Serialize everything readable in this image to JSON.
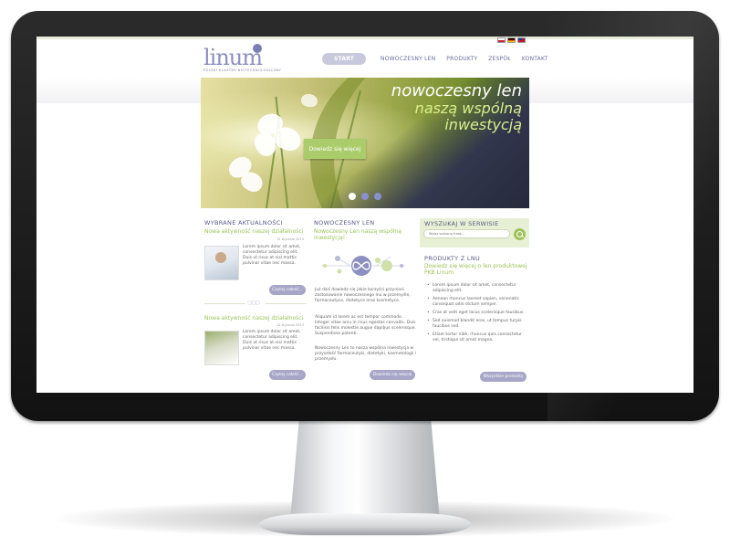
{
  "site": {
    "logo_text": "linum",
    "logo_tagline": "POLSKI KLASTER BIOTECHNOLOGICZNY",
    "languages": [
      "PL",
      "DE",
      "EN"
    ],
    "nav": [
      {
        "label": "START",
        "active": true
      },
      {
        "label": "NOWOCZESNY LEN",
        "active": false
      },
      {
        "label": "PRODUKTY",
        "active": false
      },
      {
        "label": "ZESPÓŁ",
        "active": false
      },
      {
        "label": "KONTAKT",
        "active": false
      }
    ]
  },
  "hero": {
    "line1": "nowoczesny len",
    "line2": "naszą wspólną",
    "line3": "inwestycją",
    "button": "Dowiedz się więcej",
    "slides": 3,
    "active_slide": 1
  },
  "news": {
    "title": "WYBRANE AKTUALNOŚCI",
    "items": [
      {
        "heading": "Nowa aktywność naszej działalności",
        "date": "12 stycznia 2013",
        "text": "Lorem ipsum dolor sit amet, consectetur adipiscing elit. Duis ut risus at nisi mattis pulvinar vitae nec massa.",
        "button": "Czytaj całość..."
      },
      {
        "heading": "Nowa aktywność naszej działalności",
        "date": "12 stycznia 2013",
        "text": "Lorem ipsum dolor sit amet, consectetur adipiscing elit. Duis ut risus at nisi mattis pulvinar vitae nec massa.",
        "button": "Czytaj całość..."
      }
    ]
  },
  "modern_flax": {
    "title": "NOWOCZESNY LEN",
    "subtitle": "Nowoczesny Len naszą wspólną inwestycją!",
    "para1": "Już dziś dowiedz się jakie korzyści przyniosi zastosowanie nowoczesnego lnu w przemyśle, farmaceutyce, dietetyce oraz kosmetyce.",
    "para2": "Aliquam id lorem ac est tempor commodo. Integer vitae arcu in risus egestas convallis. Duis facilisis felis molestie augue dapibus scelerisque. Suspendisse potenti.",
    "para3": "Nowoczesny Len to nasza wspólna inwestycja w przyszłość farmaceutyki, dietetyki, kosmetologii i przemysłu.",
    "button": "Dowiedz się więcej"
  },
  "search": {
    "title": "WYSZUKAJ W SERWISIE",
    "placeholder": "Wpisz szukaną frazę..."
  },
  "products": {
    "title": "PRODUKTY Z LNU",
    "subtitle": "Dowiedz się więcej o len produktowej PKB Linum",
    "items": [
      "Lorem ipsum dolor sit amet, consectetur adipiscing elit.",
      "Aenean rhoncus laoreet sapien, venenatis consequat odio dictum semper.",
      "Cras at velit eget lacus scelerisque faucibus.",
      "Sed euismod blandit eros, ut tempus turpis faucibus sed.",
      "Etiam tortor nibh, rhoncus quis consectetur vel, tristique sit amet magna."
    ],
    "button": "Wszystkie produkty"
  },
  "colors": {
    "accent_purple": "#8c8fc0",
    "accent_green": "#9dc25a",
    "bezel": "#1a1a1a"
  }
}
